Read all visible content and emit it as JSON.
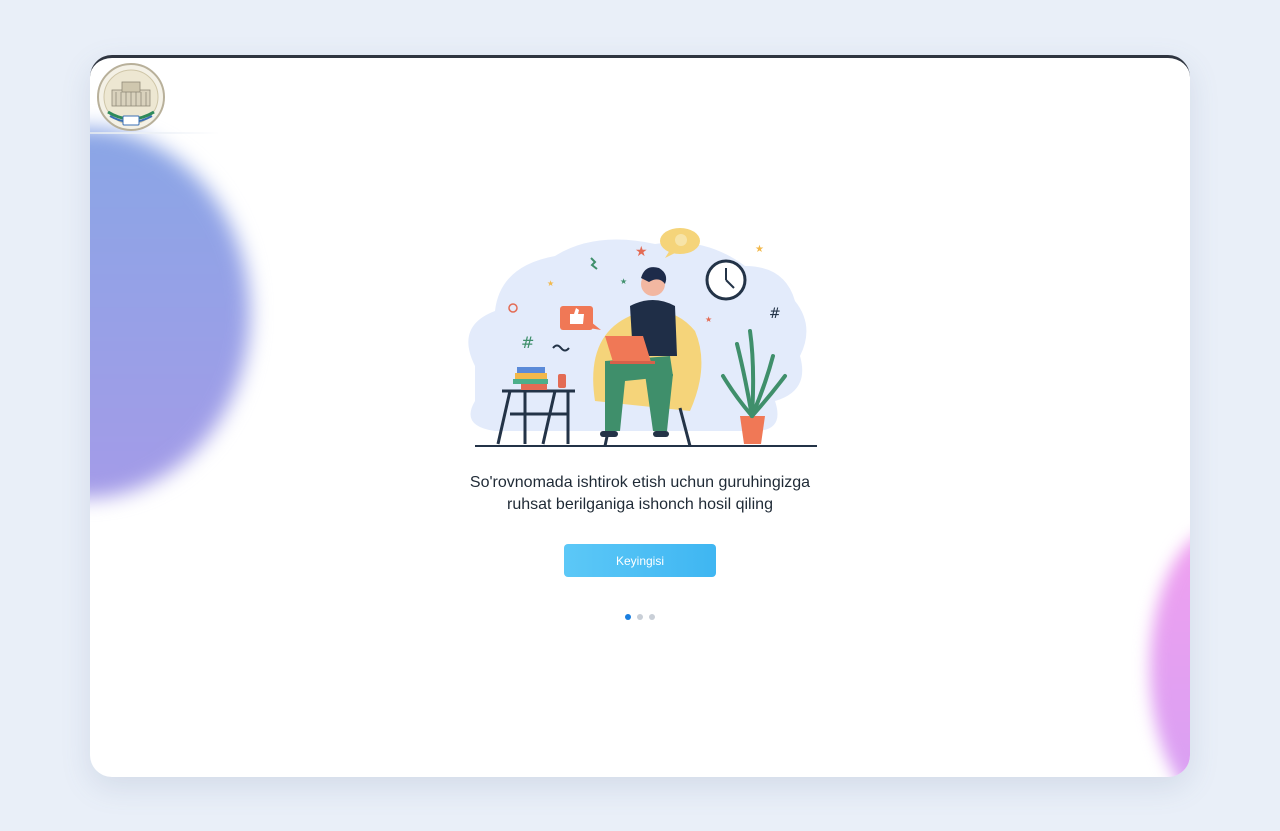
{
  "logo": {
    "icon": "university-emblem-icon"
  },
  "onboarding": {
    "message_line1": "So'rovnomada ishtirok etish uchun guruhingizga",
    "message_line2": "ruhsat berilganiga ishonch hosil qiling",
    "next_label": "Keyingisi",
    "steps": 3,
    "active_step": 1
  },
  "colors": {
    "background": "#e9eff8",
    "button": "#4bbef4",
    "dot_active": "#1a7fe0",
    "dot_inactive": "#c9cfd7"
  }
}
